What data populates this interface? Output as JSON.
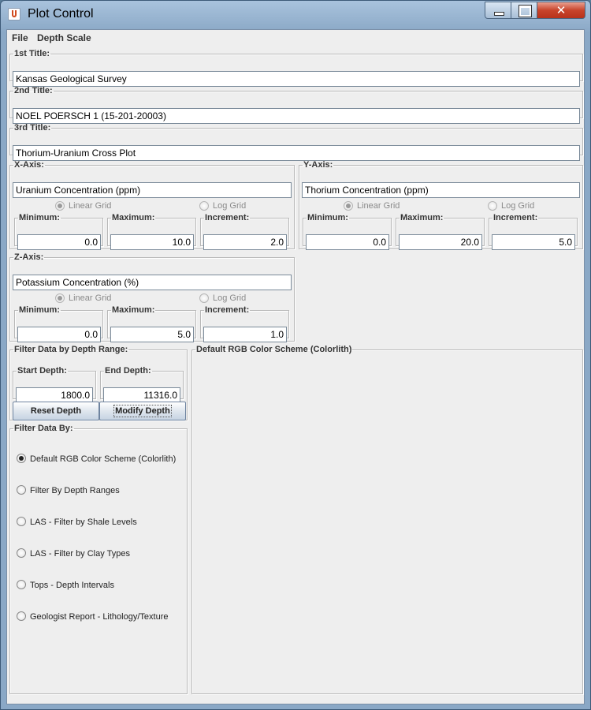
{
  "window": {
    "title": "Plot Control"
  },
  "menu": {
    "file": "File",
    "depth_scale": "Depth Scale"
  },
  "titles": {
    "first_label": "1st Title:",
    "first_value": "Kansas Geological Survey",
    "second_label": "2nd Title:",
    "second_value": "NOEL POERSCH 1 (15-201-20003)",
    "third_label": "3rd Title:",
    "third_value": "Thorium-Uranium Cross Plot"
  },
  "x_axis": {
    "legend": "X-Axis:",
    "title": "Uranium Concentration (ppm)",
    "linear_label": "Linear Grid",
    "log_label": "Log Grid",
    "min_label": "Minimum:",
    "min": "0.0",
    "max_label": "Maximum:",
    "max": "10.0",
    "inc_label": "Increment:",
    "inc": "2.0"
  },
  "y_axis": {
    "legend": "Y-Axis:",
    "title": "Thorium Concentration (ppm)",
    "linear_label": "Linear Grid",
    "log_label": "Log Grid",
    "min_label": "Minimum:",
    "min": "0.0",
    "max_label": "Maximum:",
    "max": "20.0",
    "inc_label": "Increment:",
    "inc": "5.0"
  },
  "z_axis": {
    "legend": "Z-Axis:",
    "title": "Potassium Concentration (%)",
    "linear_label": "Linear Grid",
    "log_label": "Log Grid",
    "min_label": "Minimum:",
    "min": "0.0",
    "max_label": "Maximum:",
    "max": "5.0",
    "inc_label": "Increment:",
    "inc": "1.0"
  },
  "depth_filter": {
    "legend": "Filter Data by Depth Range:",
    "start_label": "Start Depth:",
    "start": "1800.0",
    "end_label": "End Depth:",
    "end": "11316.0",
    "reset_label": "Reset Depth",
    "modify_label": "Modify Depth"
  },
  "filter_by": {
    "legend": "Filter Data By:",
    "options": [
      "Default RGB Color Scheme (Colorlith)",
      "Filter By Depth Ranges",
      "LAS - Filter by Shale Levels",
      "LAS - Filter by Clay Types",
      "Tops - Depth Intervals",
      "Geologist Report - Lithology/Texture"
    ],
    "selected_index": 0
  },
  "scheme_panel": {
    "legend": "Default RGB Color Scheme (Colorlith)"
  }
}
